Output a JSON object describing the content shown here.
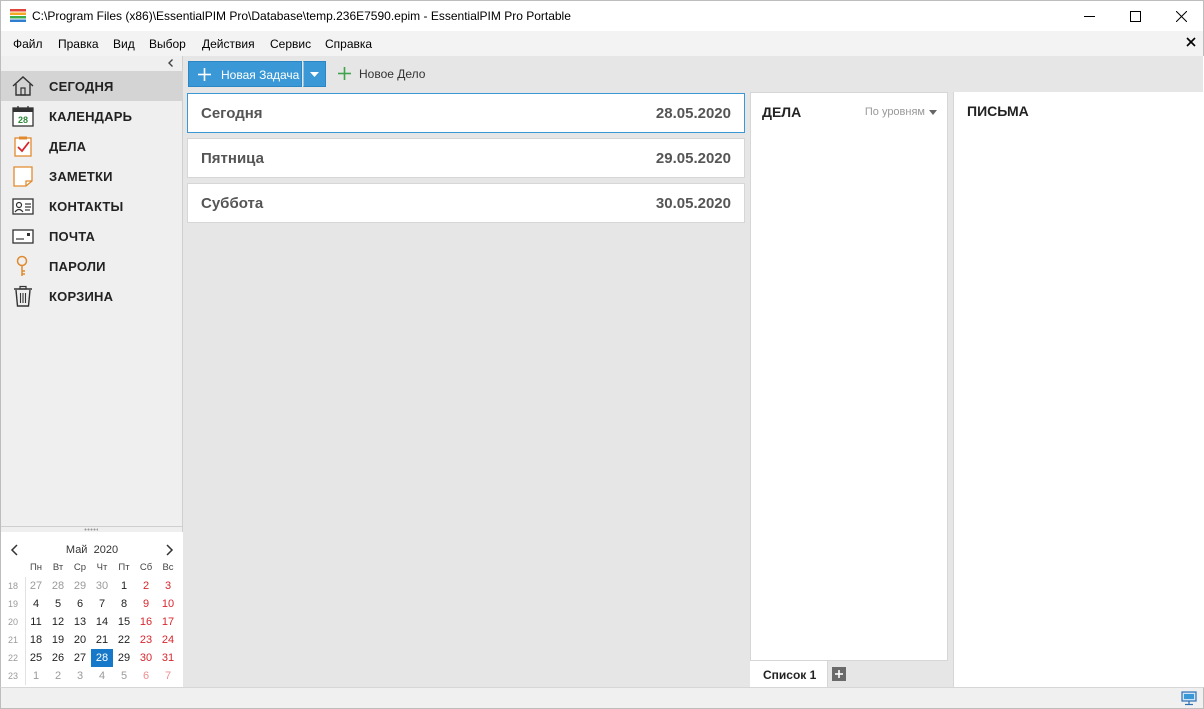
{
  "window": {
    "title": "C:\\Program Files (x86)\\EssentialPIM Pro\\Database\\temp.236E7590.epim - EssentialPIM Pro Portable"
  },
  "menu": {
    "file": "Файл",
    "edit": "Правка",
    "view": "Вид",
    "select": "Выбор",
    "actions": "Действия",
    "service": "Сервис",
    "help": "Справка"
  },
  "sidebar": {
    "items": [
      {
        "label": "СЕГОДНЯ",
        "icon": "home-icon",
        "active": true
      },
      {
        "label": "КАЛЕНДАРЬ",
        "icon": "calendar-icon"
      },
      {
        "label": "ДЕЛА",
        "icon": "tasks-icon"
      },
      {
        "label": "ЗАМЕТКИ",
        "icon": "notes-icon"
      },
      {
        "label": "КОНТАКТЫ",
        "icon": "contacts-icon"
      },
      {
        "label": "ПОЧТА",
        "icon": "mail-icon"
      },
      {
        "label": "ПАРОЛИ",
        "icon": "key-icon"
      },
      {
        "label": "КОРЗИНА",
        "icon": "trash-icon"
      }
    ],
    "calendar_icon_day": "28"
  },
  "calendar": {
    "month": "Май",
    "year": "2020",
    "weekdays": [
      "Пн",
      "Вт",
      "Ср",
      "Чт",
      "Пт",
      "Сб",
      "Вс"
    ],
    "weeks": [
      {
        "num": "18",
        "days": [
          "27",
          "28",
          "29",
          "30",
          "1",
          "2",
          "3"
        ]
      },
      {
        "num": "19",
        "days": [
          "4",
          "5",
          "6",
          "7",
          "8",
          "9",
          "10"
        ]
      },
      {
        "num": "20",
        "days": [
          "11",
          "12",
          "13",
          "14",
          "15",
          "16",
          "17"
        ]
      },
      {
        "num": "21",
        "days": [
          "18",
          "19",
          "20",
          "21",
          "22",
          "23",
          "24"
        ]
      },
      {
        "num": "22",
        "days": [
          "25",
          "26",
          "27",
          "28",
          "29",
          "30",
          "31"
        ]
      },
      {
        "num": "23",
        "days": [
          "1",
          "2",
          "3",
          "4",
          "5",
          "6",
          "7"
        ]
      }
    ],
    "today": "28",
    "colors": {
      "weekend": "#d9262c",
      "today_bg": "#1578c8"
    }
  },
  "toolbar": {
    "new_task_label": "Новая Задача",
    "new_item_label": "Новое Дело"
  },
  "today": {
    "days": [
      {
        "name": "Сегодня",
        "date": "28.05.2020"
      },
      {
        "name": "Пятница",
        "date": "29.05.2020"
      },
      {
        "name": "Суббота",
        "date": "30.05.2020"
      }
    ]
  },
  "tasks_panel": {
    "title": "ДЕЛА",
    "group_by": "По уровням",
    "tab_label": "Список 1"
  },
  "mail_panel": {
    "title": "ПИСЬМА"
  },
  "theme": {
    "accent": "#3a98d6",
    "green_plus": "#4caf50"
  }
}
